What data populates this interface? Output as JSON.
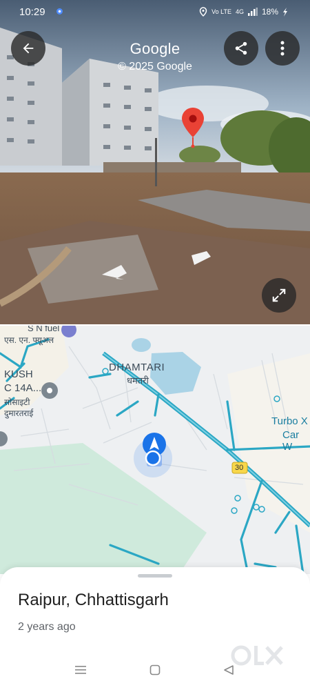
{
  "status_bar": {
    "time": "10:29",
    "network": "Vo LTE",
    "signal": "4G",
    "battery": "18%"
  },
  "street_view": {
    "brand": "Google",
    "copyright": "© 2025 Google"
  },
  "map": {
    "labels": {
      "s_n_fuel": "S N fuel",
      "s_n_fuel_hi": "एस. एन. फ्यूअल",
      "kush": "KUSH",
      "kush_14a": "C 14A...",
      "society_hi": "सोसाइटी",
      "dumartarai_hi": "दुमारतराई",
      "dhamtari": "DHAMTARI",
      "dhamtari_hi": "धमतरी",
      "turbo_1": "Turbo X",
      "turbo_2": "Car W",
      "route": "30"
    }
  },
  "sheet": {
    "place": "Raipur, Chhattisgarh",
    "when": "2 years ago"
  },
  "watermark": "OLX",
  "colors": {
    "pin": "#e94235",
    "road": "#2ba7c4",
    "water": "#aad3e6",
    "location": "#1a73e8"
  }
}
